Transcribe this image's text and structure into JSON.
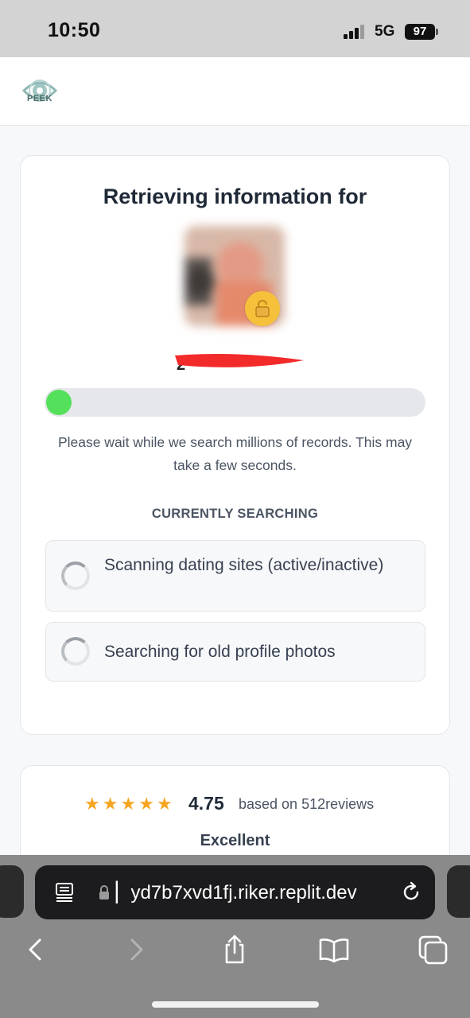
{
  "status_bar": {
    "time": "10:50",
    "network": "5G",
    "battery": "97"
  },
  "header": {
    "logo_text": "PEEK",
    "logo_icon": "eye-icon"
  },
  "main": {
    "title": "Retrieving information for",
    "progress": 0.02,
    "wait_text": "Please wait while we search millions of records. This may take a few seconds.",
    "section_label": "CURRENTLY SEARCHING",
    "search_items": [
      {
        "label": "Scanning dating sites (active/inactive)",
        "icon": "spinner-icon"
      },
      {
        "label": "Searching for old profile photos",
        "icon": "spinner-icon"
      }
    ]
  },
  "reviews": {
    "stars": 5,
    "rating": "4.75",
    "note": "based on 512reviews",
    "rating_word": "Excellent"
  },
  "browser": {
    "url": "▏yd7b7xvd1fj.riker.replit.dev",
    "icons": [
      "reader-icon",
      "lock-icon",
      "reload-icon",
      "back-icon",
      "forward-icon",
      "share-icon",
      "bookmarks-icon",
      "tabs-icon"
    ]
  },
  "colors": {
    "progress": "#55e05c",
    "star": "#f5a623",
    "lock_badge": "#f5c13b"
  }
}
